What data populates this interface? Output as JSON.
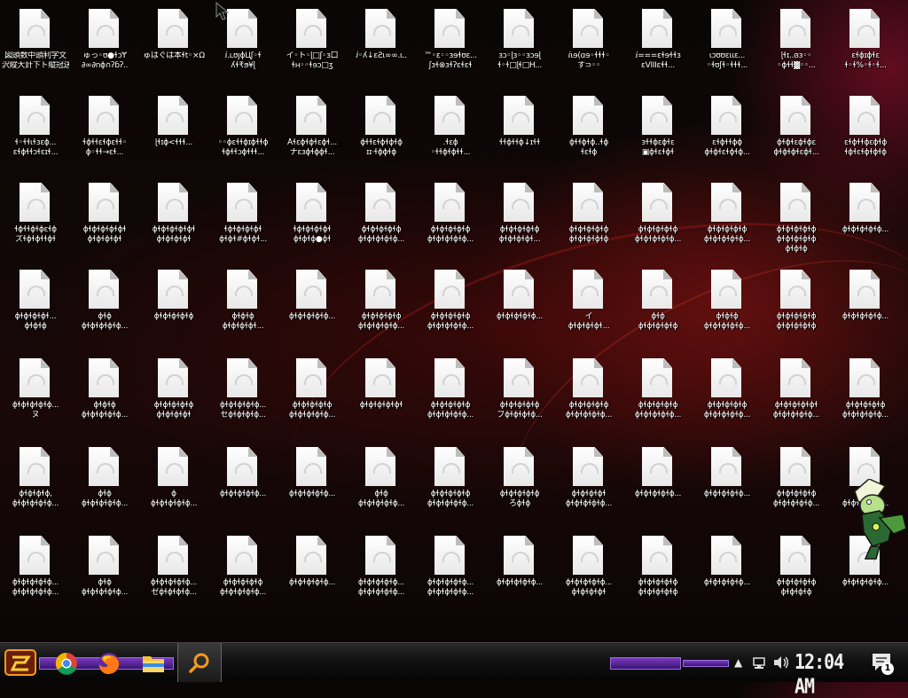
{
  "desktop": {
    "icon_labels": [
      [
        "図頭数中頭利字文",
        "沢縦大計下ト縦冠送"
      ],
      [
        "ゅっ◦ʊ●ɬↄɎ",
        "∂∞∂nɸ∩ʔɓʔ.."
      ],
      [
        "ゅはぐは本ɬt◦×Ω",
        ""
      ],
      [
        "ⅈ.ʟʊȷϕЦʃ◦ɬ",
        "ʎɬ₹ϧ¥ɭ"
      ],
      [
        "イ◦ト◦ɭ□ʃ◦ɜ口",
        "ɬʜ◦◦ɬɘɔ□ʒ"
      ],
      [
        "ⅈ◦ʎ↓ɛƧɩ∞∞.ɩ..",
        ""
      ],
      [
        "™◦ɛ◦◦ɜɘɬʊɛ...",
        "ʃɜɬ⊗ɜɬʔɛɬɛɬ"
      ],
      [
        "ɜɔ◦ɭɜ◦◦ɜɔɘɭ",
        "ɬ◦ɬ□ɭɬ□H..."
      ],
      [
        "ⅈɩɘ(ɑɘ◦ɬɬɬ◦",
        "す⊃◦◦"
      ],
      [
        "ⅈ===ɛɬɘɬɬɜ",
        "ɛVIIIɛɬɬ..."
      ],
      [
        "ɩɔʊʊɛɩɩɛ...",
        "◦ɬʊʃɬ◦ɬɬɬ..."
      ],
      [
        "ɭɬɪ..ɞɜ◦◦",
        "◦ɸɬɬ▓◦◦..."
      ],
      [
        "ɛɬɸɪɸɬɛ",
        "ɬ◦ɬ%◦ɬ◦ɬ..."
      ],
      [
        "ɬ◦ɬɬɩɬɜɛɸ...",
        "ɛɬɸɬɬɔɬɛɪɬ..."
      ],
      [
        "ɬɸɬɬɛɬɸɛɬɬ◦",
        "ɸ◦ɬɬ→ɛɬ..."
      ],
      [
        "ɭɬɪɸ<ɬɬɬ...",
        ""
      ],
      [
        "◦◦ɸɛɬɬɸɪɸɬɬɸ",
        "ɬɸɬɬɔɸɬɬɬ..."
      ],
      [
        "Åɬɛɸɬɸɬɛɸɬ...",
        "ナɛɜɸɬɸɸɬ..."
      ],
      [
        "ɸɬɬɛɬɸɬɸɬɸ",
        "ɪɪ·ɬɸɸɬɸ"
      ],
      [
        ".ɬɛɸ",
        "◦ɬɬɸɬɸɬɬ..."
      ],
      [
        "ɬɬɸɬɬɸ↓ɪɬɬ",
        ""
      ],
      [
        "ɸɬɬɸɬɸ..ɬɸ",
        "ɬɛɬɸ"
      ],
      [
        "ɜɬɬɸɛɸɬɛ",
        "▣ɸɬɛɬɸɬ"
      ],
      [
        "ɛɬɸɬɬɸɸ",
        "ɸɬɸɬɛɬɸɬɸ..."
      ],
      [
        "ɸɬɸɬɛɸɬɸɛ",
        "ɸɬɸɬɸɬɛɸɬ..."
      ],
      [
        "ɛɬɸɬɬɸɛɸɬɸ",
        "ɬɸɬɛɬɸɬɸɬɸ"
      ],
      [
        "ɬɸɬɬɸɬɸɛɬɸ",
        "ズɬɸɬɸɬɬɸɬ"
      ],
      [
        "ɸɬɸɬɸɬɸɬɸɬ",
        "ɸɬɸɬɸɬɸɬ"
      ],
      [
        "ɸɬɸɬɸɬɸɬɸɬ",
        "ɸɬɸɬɸɬɸɬ"
      ],
      [
        "ɬɸɬɸɬɸɬɸɬ",
        "ɸɬɸɬ#ɸɬɸɬ..."
      ],
      [
        "ɬɸɬɸɬɸɬɸɬ",
        "ɸɬɸɬɸ●ɸɬ"
      ],
      [
        "ɸɬɸɬɸɬɸɬɸ",
        "ɸɬɸɬɸɬɸɬɸ..."
      ],
      [
        "ɸɬɸɬɸɬɸɬɸ",
        "ɸɬɸɬɸɬɸɬɸ..."
      ],
      [
        "ɸɬɸɬɸɬɸɬɸ",
        "ɸɬɸɬɸɬɸɬ..."
      ],
      [
        "ɸɬɸɬɸɬɸɬɸ",
        "ɸɬɸɬɸɬɸɬɸ"
      ],
      [
        "ɸɬɸɬɸɬɸɬɸ",
        "ɸɬɸɬɸɬɸɬɸ..."
      ],
      [
        "ɸɬɸɬɸɬɸɬɸ",
        "ɸɬɸɬɸɬɸɬɸ..."
      ],
      [
        "ɸɬɸɬɸɬɸɬɸ",
        "ɸɬɸɬɸɬɸɬɸ",
        "ɸɬɸɬɸ"
      ],
      [
        "ɸɬɸɬɸɬɸɬɸ...",
        ""
      ],
      [
        "ɸɬɸɬɸɬɸɬ...",
        "ɸɬɸɬɸ"
      ],
      [
        "ɸɬɸ",
        "ɸɬɸɬɸɬɸɬɸ..."
      ],
      [
        "ɸɬɸɬɸɬɸɬɸ",
        ""
      ],
      [
        "ɸɬɸɬɸ",
        "ɸɬɸɬɸɬɸɬ..."
      ],
      [
        "ɸɬɸɬɸɬɸɬɸ...",
        ""
      ],
      [
        "ɸɬɸɬɸɬɸɬɸ",
        "ɸɬɸɬɸɬɸɬɸ..."
      ],
      [
        "ɸɬɸɬɸɬɸɬɸ",
        "ɸɬɸɬɸɬɸɬɸ..."
      ],
      [
        "ɸɬɸɬɸɬɸɬɸ...",
        ""
      ],
      [
        "イ",
        "ɸɬɸɬɸɬɸɬ..."
      ],
      [
        "ɸɬɸ",
        "ɸɬɸɬɸɬɸɬɸ"
      ],
      [
        "ɸɬɸɬɸ",
        "ɸɬɸɬɸɬɸɬɸ..."
      ],
      [
        "ɸɬɸɬɸɬɸɬɸ",
        "ɸɬɸɬɸɬɸɬɸ"
      ],
      [
        "ɸɬɸɬɸɬɸɬɸ...",
        ""
      ],
      [
        "ɸɬɸɬɸɬɸɬɸ...",
        "ヌ"
      ],
      [
        "ɸɬɸɬɸ",
        "ɸɬɸɬɸɬɸɬɸ..."
      ],
      [
        "ɸɬɸɬɸɬɸɬɸ",
        "ɸɬɸɬɸɬɸɬ"
      ],
      [
        "ɸɬɸɬɸɬɸɬɸ...",
        "セɸɬɸɬɸɬɸ..."
      ],
      [
        "ɸɬɸɬɸɬɸɬɸ",
        "ɸɬɸɬɸɬɸɬɸ..."
      ],
      [
        "ɸɬɸɬɸɬɸɬɸɬ",
        ""
      ],
      [
        "ɸɬɸɬɸɬɸɬɸ",
        "ɸɬɸɬɸɬɸɬɸ..."
      ],
      [
        "ɸɬɸɬɸɬɸɬɸ",
        "ブɸɬɸɬɸɬɸ..."
      ],
      [
        "ɸɬɸɬɸɬɸɬɸ",
        "ɸɬɸɬɸɬɸɬɸ..."
      ],
      [
        "ɸɬɸɬɸɬɸɬɸ",
        "ɸɬɸɬɸɬɸɬɸ..."
      ],
      [
        "ɸɬɸɬɸɬɸɬɸ",
        "ɸɬɸɬɸɬɸɬɸ..."
      ],
      [
        "ɸɬɸɬɸɬɸɬɸɬ",
        "ɸɬɸɬɸɬɸɬɸ..."
      ],
      [
        "ɸɬɸɬɸɬɸɬɸ",
        "ɸɬɸɬɸɬɸɬɸ..."
      ],
      [
        "ɸɬɸɬɸɬɸ,",
        "ɸɬɸɬɸɬɸɬɸ..."
      ],
      [
        "ɸɬɸ",
        "ɸɬɸɬɸɬɸɬɸ..."
      ],
      [
        "ɸ",
        "ɸɬɸɬɸɬɸɬɸ..."
      ],
      [
        "ɸɬɸɬɸɬɸɬɸ...",
        ""
      ],
      [
        "ɸɬɸɬɸɬɸɬɸ...",
        ""
      ],
      [
        "ɸɬɸ",
        "ɸɬɸɬɸɬɸɬɸ..."
      ],
      [
        "ɸɬɸɬɸɬɸɬɸ",
        "ɸɬɸɬɸɬɸɬɸ..."
      ],
      [
        "ɸɬɸɬɸɬɸɬɸ",
        "ろɸɬɸ"
      ],
      [
        "ɸɬɸɬɸɬɸɬ",
        "ɸɬɸɬɸɬɸɬɸ..."
      ],
      [
        "ɸɬɸɬɸɬɸɬɸ...",
        ""
      ],
      [
        "ɸɬɸɬɸɬɸɬɸ...",
        ""
      ],
      [
        "ɸɬɸɬɸɬɸɬɸ",
        "ɸɬɸɬɸɬɸɬɸ..."
      ],
      [
        "ɸɬɸɬ",
        "ɸɬɸɬɸɬɸɬɸ..."
      ],
      [
        "ɸɬɸɬɸɬɸɬɸ...",
        "ɸɬɸɬɸɬɸɬɸ..."
      ],
      [
        "ɸɬɸ",
        "ɸɬɸɬɸɬɸɬɸ..."
      ],
      [
        "ɸɬɸɬɸɬɸɬɸ...",
        "ゼɸɬɸɬɸɬɸ..."
      ],
      [
        "ɸɬɸɬɸɬɸɬɸ",
        "ɸɬɸɬɸɬɸɬɸ..."
      ],
      [
        "ɸɬɸɬɸɬɸɬɸ...",
        ""
      ],
      [
        "ɸɬɸɬɸɬɸɬɸ...",
        "ɸɬɸɬɸɬɸɬɸ..."
      ],
      [
        "ɸɬɸɬɸɬɸɬɸ...",
        "ɸɬɸɬɸɬɸɬɸ..."
      ],
      [
        "ɸɬɸɬɸɬɸɬɸ...",
        ""
      ],
      [
        "ɸɬɸɬɸɬɸɬɸ...",
        "ɸɬɸɬɸɬɸɬ"
      ],
      [
        "ɸɬɸɬɸɬɸɬɸ",
        "ɸɬɸɬɸɬɸɬɸ"
      ],
      [
        "ɸɬɸɬɸɬɸɬɸ...",
        ""
      ],
      [
        "ɸɬɸɬɸɬɸɬɸ",
        "ɸɬɸɬɸɬɸ"
      ],
      [
        "ɸɬɸɬɸɬɸɬɸ...",
        ""
      ]
    ],
    "file_icon_name": "blank-file-icon"
  },
  "taskbar": {
    "pinned": [
      "chrome-icon",
      "firefox-icon",
      "file-explorer-icon",
      "search-icon"
    ],
    "clock": "12:04 AM",
    "notification_count": "1",
    "accent_color": "#7a3ac0"
  }
}
